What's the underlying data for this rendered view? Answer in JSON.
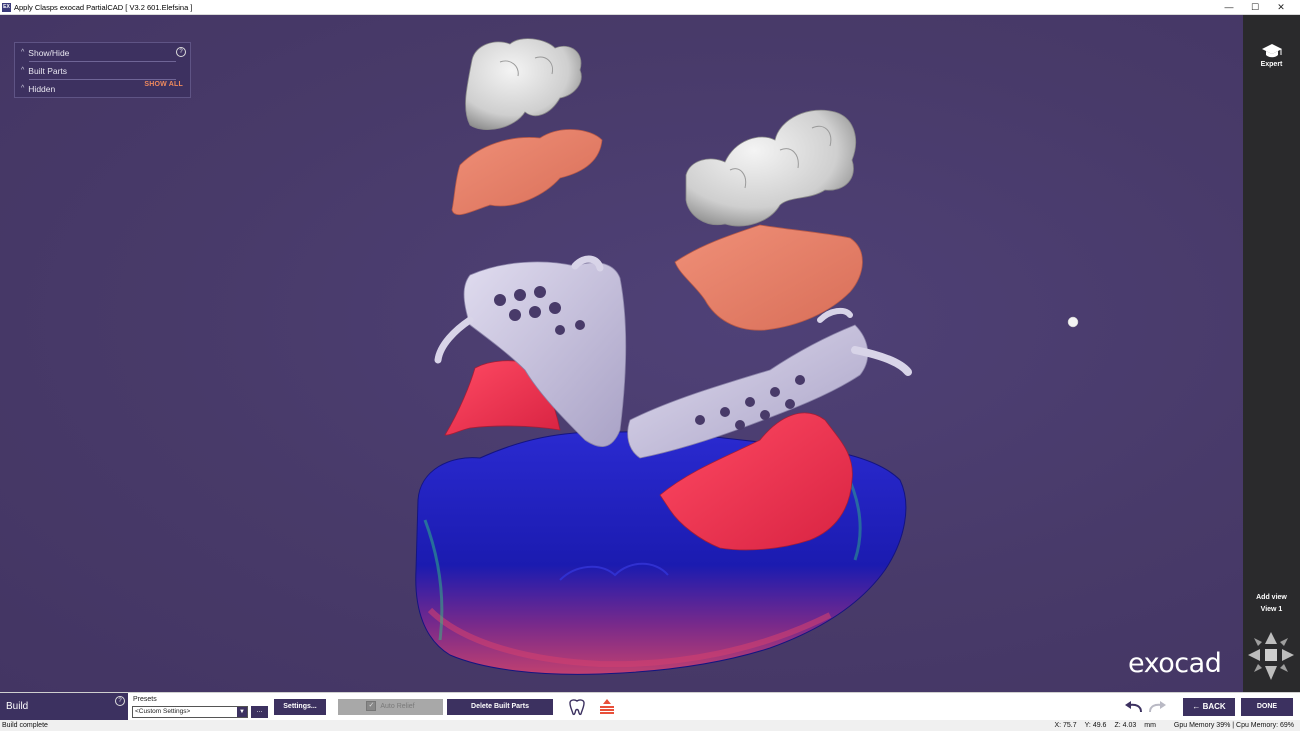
{
  "window": {
    "title": "Apply Clasps exocad PartialCAD [ V3.2 601.Elefsina ]",
    "app_icon_text": "EX",
    "controls": {
      "minimize": "—",
      "maximize": "☐",
      "close": "✕"
    }
  },
  "panel": {
    "rows": [
      {
        "label": "Show/Hide"
      },
      {
        "label": "Built Parts"
      },
      {
        "label": "Hidden"
      }
    ],
    "show_all": "SHOW ALL",
    "help": "?"
  },
  "sidebar": {
    "expert_label": "Expert",
    "add_view_label": "Add view",
    "view_label": "View 1"
  },
  "brand": {
    "logo_text": "exocad"
  },
  "toolbar": {
    "mode_label": "Build",
    "help": "?",
    "presets_label": "Presets",
    "presets_value": "<Custom Settings>",
    "presets_more": "...",
    "settings_button": "Settings...",
    "auto_relief_label": "Auto Relief",
    "delete_built_parts_button": "Delete Built Parts",
    "back_button": "BACK",
    "done_button": "DONE"
  },
  "status": {
    "message": "Build complete",
    "x": "X: 75.7",
    "y": "Y: 49.6",
    "z": "Z: 4.03",
    "unit": "mm",
    "gpu_memory": "Gpu Memory 39% | Cpu Memory: 69%"
  },
  "colors": {
    "viewport_bg": "#483a69",
    "accent": "#3c3160",
    "show_all": "#f08a5d",
    "gingiva": "#e8816a",
    "framework": "#c8c2dc",
    "relief": "#e8324f",
    "model_blue": "#1f1fbf"
  }
}
